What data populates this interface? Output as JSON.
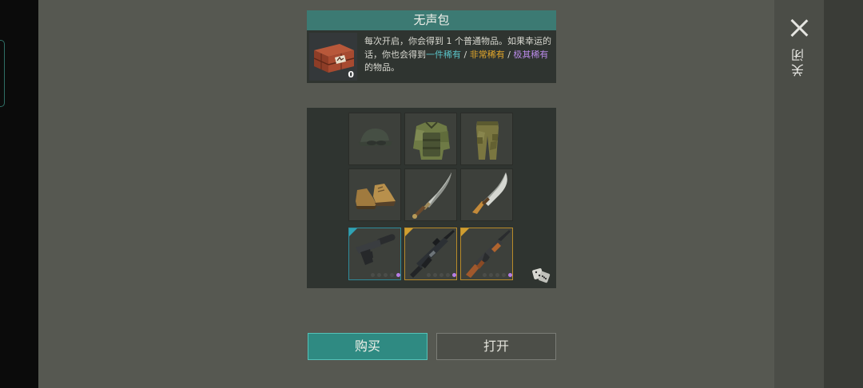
{
  "close": {
    "label": "关闭"
  },
  "crate": {
    "title": "无声包",
    "count": "0",
    "desc_prefix": "每次开启，你会得到 1 个普通物品。如果幸运的话，你也会得到",
    "rarity_uncommon": "一件稀有",
    "separator_1": " / ",
    "rarity_rare": "非常稀有",
    "separator_2": " / ",
    "rarity_epic": "极其稀有",
    "desc_suffix": "的物品。"
  },
  "loot": {
    "items": [
      {
        "name": "cap",
        "icon": "cap-icon",
        "row": 0,
        "col": 0,
        "dimmed": true
      },
      {
        "name": "camo-vest",
        "icon": "vest-icon",
        "row": 0,
        "col": 1
      },
      {
        "name": "camo-pants",
        "icon": "pants-icon",
        "row": 0,
        "col": 2
      },
      {
        "name": "boots",
        "icon": "boots-icon",
        "row": 1,
        "col": 0
      },
      {
        "name": "sabre",
        "icon": "sabre-icon",
        "row": 1,
        "col": 1
      },
      {
        "name": "machete",
        "icon": "machete-icon",
        "row": 1,
        "col": 2
      },
      {
        "name": "silenced-pistol",
        "icon": "pistol-icon",
        "row": 2,
        "col": 0,
        "tier": "blue",
        "upgrade_dots": 5,
        "filled_dots": 1
      },
      {
        "name": "assault-rifle",
        "icon": "m16-icon",
        "row": 2,
        "col": 1,
        "tier": "gold",
        "upgrade_dots": 5,
        "filled_dots": 1
      },
      {
        "name": "kalashnikov",
        "icon": "ak-icon",
        "row": 2,
        "col": 2,
        "tier": "gold",
        "upgrade_dots": 5,
        "filled_dots": 1
      }
    ],
    "dice_icon": "dice-icon"
  },
  "colors": {
    "accent": "#3c7a73",
    "buy_button": "#2f8a82",
    "uncommon": "#5ac3c7",
    "rare": "#e3a82b",
    "epic": "#b98ae8"
  },
  "buttons": {
    "buy": "购买",
    "open": "打开"
  }
}
